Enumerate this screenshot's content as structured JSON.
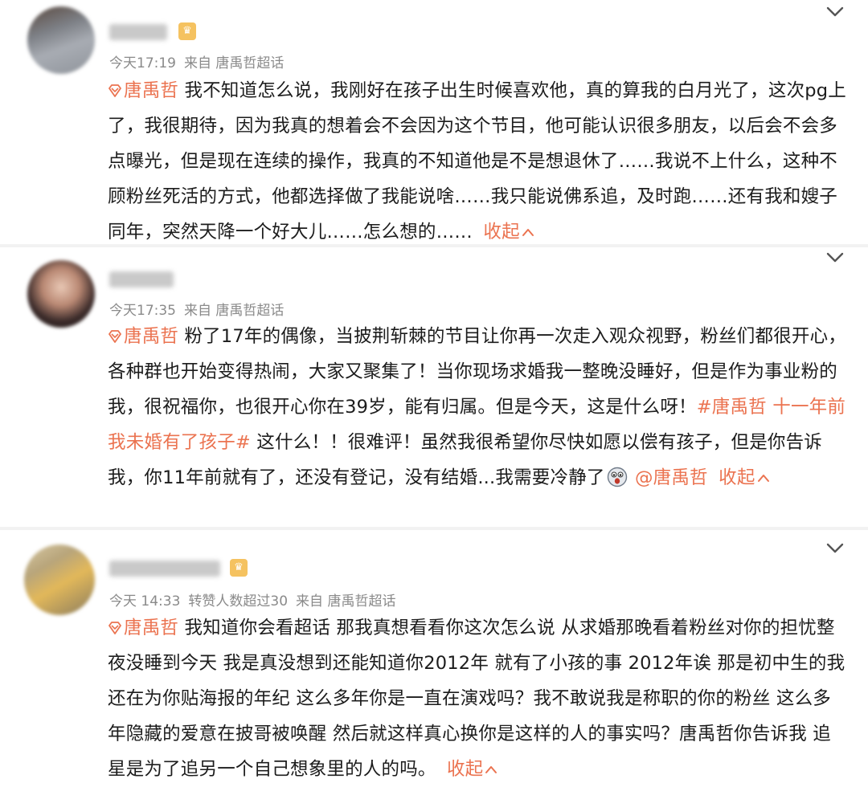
{
  "icons": {
    "topic": "diamond-topic-icon",
    "collapse": "chevron-up-icon",
    "menu": "chevron-down-icon",
    "badge": "fan-badge-icon",
    "emoji": "shocked-face-icon"
  },
  "colors": {
    "link": "#eb7350",
    "meta": "#8a8a8a",
    "text": "#1c1c1c"
  },
  "posts": [
    {
      "time": "今天17:19",
      "source": "来自 唐禹哲超话",
      "topic": "唐禹哲",
      "body": "我不知道怎么说，我刚好在孩子出生时候喜欢他，真的算我的白月光了，这次pg上了，我很期待，因为我真的想着会不会因为这个节目，他可能认识很多朋友，以后会不会多点曝光，但是现在连续的操作，我真的不知道他是不是想退休了……我说不上什么，这种不顾粉丝死活的方式，他都选择做了我能说啥……我只能说佛系追，及时跑……还有我和嫂子同年，突然天降一个好大儿……怎么想的……",
      "collapse": "收起"
    },
    {
      "time": "今天17:35",
      "source": "来自 唐禹哲超话",
      "topic": "唐禹哲",
      "body_a": "粉了17年的偶像，当披荆斩棘的节目让你再一次走入观众视野，粉丝们都很开心，各种群也开始变得热闹，大家又聚集了！当你现场求婚我一整晚没睡好，但是作为事业粉的我，很祝福你，也很开心你在39岁，能有归属。但是今天，这是什么呀！",
      "hashtag": "#唐禹哲 十一年前我未婚有了孩子#",
      "body_b": " 这什么！！很难评！虽然我很希望你尽快如愿以偿有孩子，但是你告诉我，你11年前就有了，还没有登记，没有结婚...我需要冷静了",
      "mention": "@唐禹哲",
      "collapse": "收起"
    },
    {
      "time": "今天 14:33",
      "reposts": "转赞人数超过30",
      "source": "来自 唐禹哲超话",
      "topic": "唐禹哲",
      "body": "我知道你会看超话 那我真想看看你这次怎么说 从求婚那晚看着粉丝对你的担忧整夜没睡到今天 我是真没想到还能知道你2012年 就有了小孩的事 2012年诶 那是初中生的我还在为你贴海报的年纪 这么多年你是一直在演戏吗？我不敢说我是称职的你的粉丝 这么多年隐藏的爱意在披哥被唤醒 然后就这样真心换你是这样的人的事实吗？唐禹哲你告诉我 追星是为了追另一个自己想象里的人的吗。",
      "collapse": "收起"
    }
  ]
}
